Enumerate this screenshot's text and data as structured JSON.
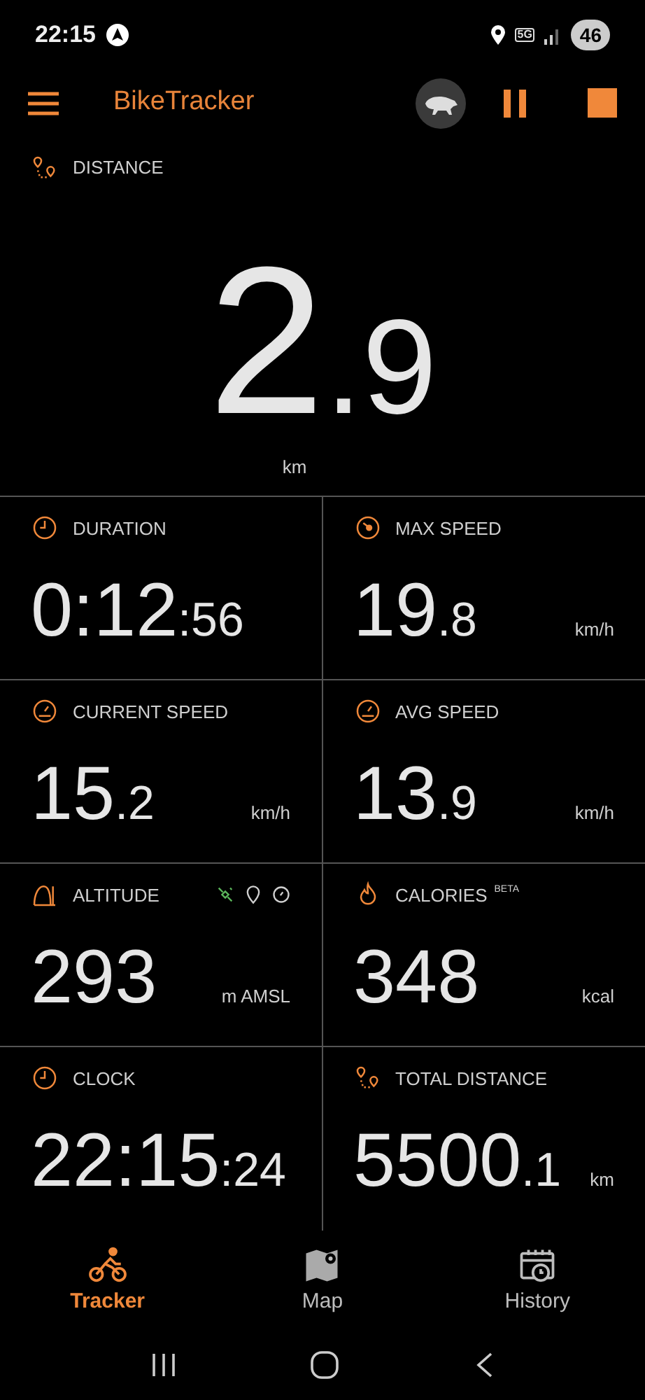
{
  "status_bar": {
    "time": "22:15",
    "network": "5G",
    "battery": "46"
  },
  "app_bar": {
    "title": "BikeTracker"
  },
  "distance": {
    "label": "DISTANCE",
    "main": "2",
    "fraction": ".9",
    "unit": "km"
  },
  "tiles": [
    {
      "kind": "duration",
      "label": "DURATION",
      "main": "0:12",
      "fraction": ":56"
    },
    {
      "kind": "max_speed",
      "label": "MAX SPEED",
      "main": "19",
      "fraction": ".8",
      "unit": "km/h"
    },
    {
      "kind": "speed",
      "label": "CURRENT SPEED",
      "main": "15",
      "fraction": ".2",
      "unit": "km/h"
    },
    {
      "kind": "speed",
      "label": "AVG SPEED",
      "main": "13",
      "fraction": ".9",
      "unit": "km/h"
    },
    {
      "kind": "altitude",
      "label": "ALTITUDE",
      "main": "293",
      "unit": "m AMSL"
    },
    {
      "kind": "calories",
      "label": "CALORIES",
      "badge": "BETA",
      "main": "348",
      "unit": "kcal"
    },
    {
      "kind": "duration",
      "label": "CLOCK",
      "main": "22:15",
      "fraction": ":24"
    },
    {
      "kind": "distance",
      "label": "TOTAL DISTANCE",
      "main": "5500",
      "fraction": ".1",
      "unit": "km"
    }
  ],
  "bottom_nav": [
    {
      "kind": "tracker",
      "label": "Tracker",
      "selected": true
    },
    {
      "kind": "map",
      "label": "Map",
      "selected": false
    },
    {
      "kind": "history",
      "label": "History",
      "selected": false
    }
  ]
}
